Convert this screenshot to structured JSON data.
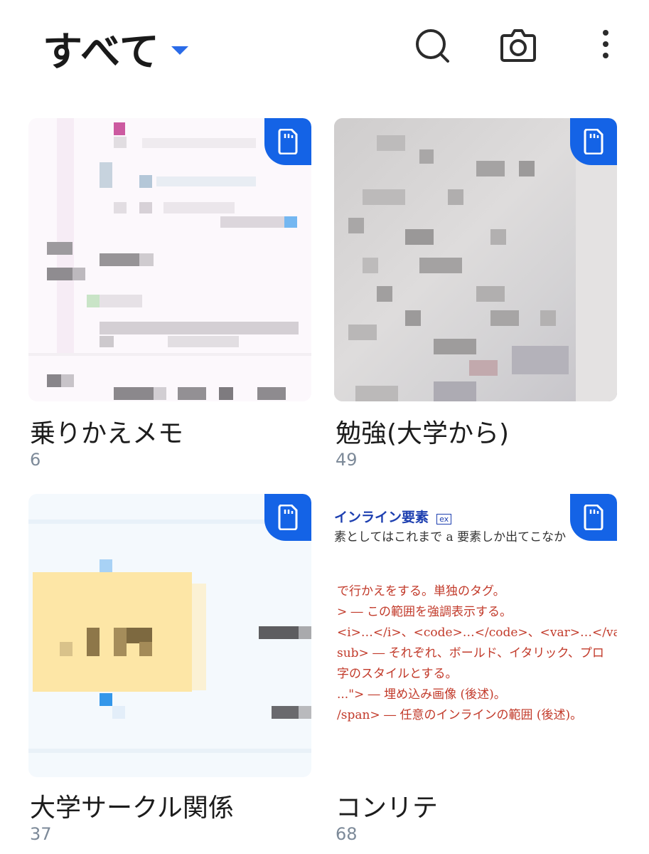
{
  "header": {
    "title": "すべて",
    "icons": [
      "search-icon",
      "camera-icon",
      "more-vert-icon"
    ],
    "accent_color": "#2a6be8"
  },
  "albums": [
    {
      "name": "乗りかえメモ",
      "count": "6",
      "badge": "sd-card-icon"
    },
    {
      "name": "勉強(大学から)",
      "count": "49",
      "badge": "sd-card-icon"
    },
    {
      "name": "大学サークル関係",
      "count": "37",
      "badge": "sd-card-icon"
    },
    {
      "name": "コンリテ",
      "count": "68",
      "badge": "sd-card-icon",
      "preview": {
        "heading": "インライン要素",
        "heading_tag": "ex",
        "intro": "素としてはこれまで a 要素しか出てこなか",
        "lines": [
          "で行かえをする。単独のタグ。",
          "> ― この範囲を強調表示する。",
          "<i>…</i>、<code>…</code>、<var>…</var>",
          "sub> ― それぞれ、ボールド、イタリック、プロ",
          "字のスタイルとする。",
          "...\"> ― 埋め込み画像 (後述)。",
          "/span> ― 任意のインラインの範囲 (後述)。"
        ]
      }
    }
  ],
  "badge_color": "#1463e6"
}
